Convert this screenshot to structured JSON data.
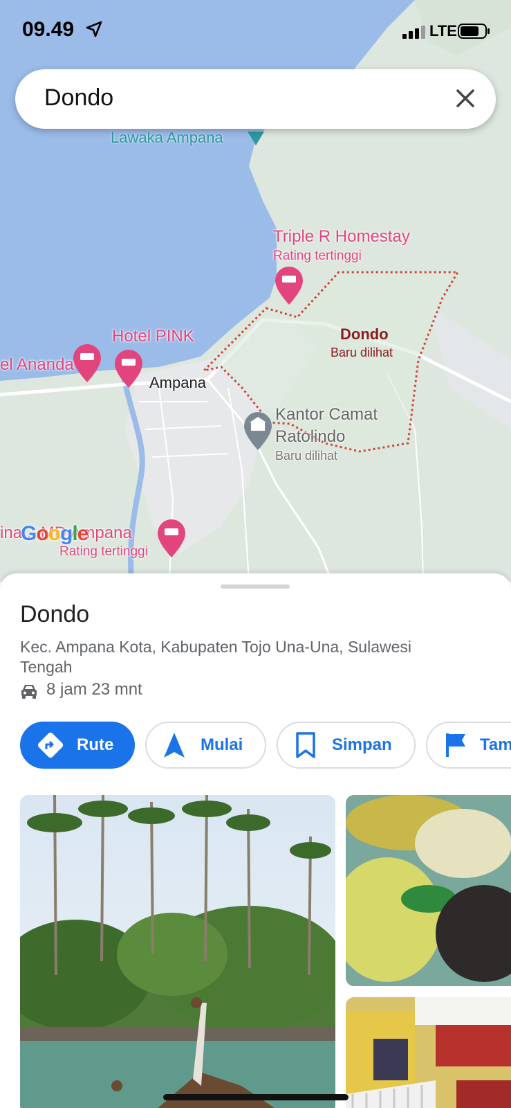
{
  "status_bar": {
    "time": "09.49",
    "network": "LTE"
  },
  "search": {
    "query": "Dondo"
  },
  "map": {
    "labels": {
      "lawaka": "Lawaka Ampana",
      "triple_r": "Triple R Homestay",
      "triple_r_sub": "Rating tertinggi",
      "hotel_pink": "Hotel PINK",
      "ananda": "el Ananda",
      "ampana": "Ampana",
      "dondo": "Dondo",
      "dondo_sub": "Baru dilihat",
      "kantor_1": "Kantor Camat",
      "kantor_2": "Ratolindo",
      "kantor_sub": "Baru dilihat",
      "pinag": "ina... MD Ampana",
      "pinag_sub": "Rating tertinggi"
    },
    "watermark": "Google"
  },
  "place": {
    "title": "Dondo",
    "address": "Kec. Ampana Kota, Kabupaten Tojo Una-Una, Sulawesi Tengah",
    "drive_time": "8 jam 23 mnt"
  },
  "actions": {
    "route": "Rute",
    "start": "Mulai",
    "save": "Simpan",
    "add_label": "Tam"
  },
  "colors": {
    "accent": "#1a73e8",
    "water": "#9bbbe9",
    "land": "#dde7dd",
    "poi": "#e2457d"
  }
}
